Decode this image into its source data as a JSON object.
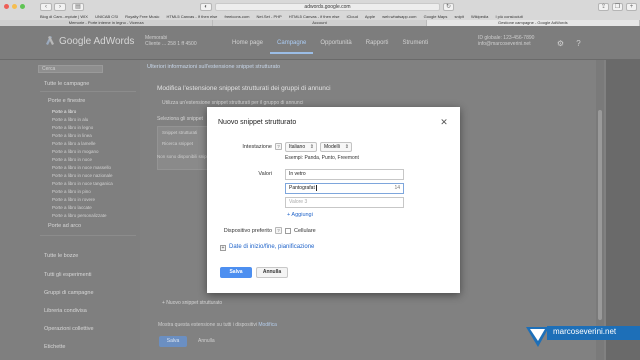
{
  "browser": {
    "url": "adwords.google.com",
    "bookmarks": [
      "Blog di Cam...mpiute | WIX",
      "UNICAB CSI",
      "Royalty Free Music",
      "HTML5 Canvas - If then else",
      "freeicons.com",
      "Net.Set - PHP",
      "HTML5 Canvas - if then else",
      "iCloud",
      "Apple",
      "web.whatsapp.com",
      "Google Maps",
      "snipit",
      "Wikipedia",
      "I più consiociuti"
    ],
    "tabs": [
      "Memorie - Porte interne in legno - Vicenza",
      "Account",
      "Gestione campagne - Google AdWords"
    ],
    "active_tab": 2
  },
  "header": {
    "logo": "Google AdWords",
    "account_name": "Memorabi",
    "account_id": "Cliente ... 258 1 ff 4500",
    "nav": [
      "Home page",
      "Campagne",
      "Opportunità",
      "Rapporti",
      "Strumenti"
    ],
    "active_nav": 1,
    "customer_line1": "ID globale: 123-456-7890",
    "customer_line2": "info@marcoseverini.net"
  },
  "sidebar": {
    "search_placeholder": "Cerca",
    "all_campaigns": "Tutte le campagne",
    "campaign": "Porte e finestre",
    "adgroups": [
      "Porte a libro",
      "Porte a libro in alu",
      "Porte a libro in legno",
      "Porte a libro in linea",
      "Porte a libro a lamelle",
      "Porte a libro in mogano",
      "Porte a libro in noce",
      "Porte a libro in noce massello",
      "Porte a libro in noce nazionale",
      "Porte a libro in noce tanganica",
      "Porte a libro in pino",
      "Porte a libro in rovere",
      "Porte a libro laccate",
      "Porte a libro personalizzate"
    ],
    "other_campaign": "Porte ad arco",
    "sections": [
      "Tutte le bozze",
      "Tutti gli esperimenti",
      "Gruppi di campagne",
      "Libreria condivisa",
      "Operazioni collettive",
      "Etichette"
    ]
  },
  "main": {
    "breadcrumb": "Ulteriori informazioni sull'estensione snippet strutturato",
    "title": "Modifica l'estensione snippet strutturati dei gruppi di annunci",
    "subtitle": "Utilizza un'estensione snippet strutturati per il gruppo di annunci",
    "select_label": "Seleziona gli snippet",
    "box_header": "Snippet strutturati",
    "box_search": "Ricerca snippet",
    "box_empty": "Non sono disponibili snippet",
    "add_snippet": "+ Nuovo snippet strutturato",
    "show_text": "Mostra questa estensione su tutti i dispositivi",
    "show_link": "Modifica",
    "save": "Salva",
    "cancel": "Annulla"
  },
  "modal": {
    "title": "Nuovo snippet strutturato",
    "close_icon": "close-icon",
    "header_label": "Intestazione",
    "language": "Italiano",
    "header_type": "Modelli",
    "examples": "Esempi: Panda, Punto, Freemont",
    "values_label": "Valori",
    "values": [
      {
        "value": "In vetro",
        "placeholder": "",
        "count": ""
      },
      {
        "value": "Pantografat",
        "placeholder": "",
        "count": "14"
      },
      {
        "value": "",
        "placeholder": "Valore 3",
        "count": ""
      }
    ],
    "add_link": "+ Aggiungi",
    "device_label": "Dispositivo preferito",
    "device_option": "Cellulare",
    "device_checked": false,
    "schedule_link": "Date di inizio/fine, pianificazione",
    "save": "Salva",
    "cancel": "Annulla"
  },
  "brand": {
    "text": "marcoseverini.net"
  }
}
